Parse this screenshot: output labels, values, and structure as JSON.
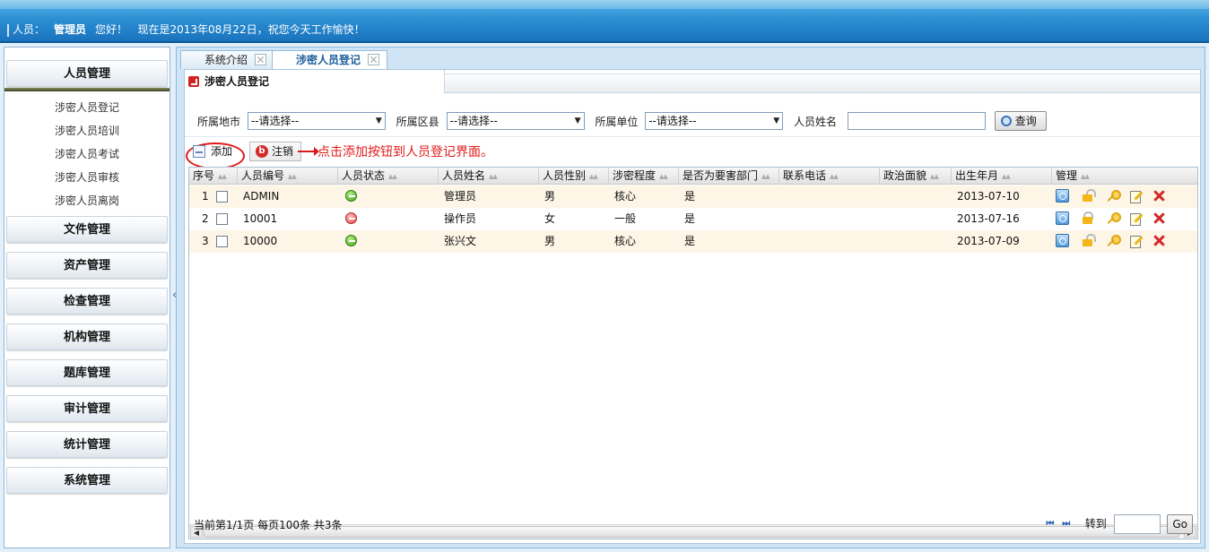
{
  "header": {
    "user_label": "人员：",
    "user_name": "管理员",
    "greeting": "您好！",
    "date_text": "现在是2013年08月22日，祝您今天工作愉快！"
  },
  "sidebar": {
    "active_menu": "人员管理",
    "sub_items": [
      "涉密人员登记",
      "涉密人员培训",
      "涉密人员考试",
      "涉密人员审核",
      "涉密人员离岗"
    ],
    "menus": [
      "文件管理",
      "资产管理",
      "检查管理",
      "机构管理",
      "题库管理",
      "审计管理",
      "统计管理",
      "系统管理"
    ],
    "collapse_glyph": "«"
  },
  "tabs": [
    {
      "label": "系统介绍",
      "active": false
    },
    {
      "label": "涉密人员登记",
      "active": true
    }
  ],
  "panel": {
    "title": "涉密人员登记"
  },
  "filters": {
    "city_label": "所属地市",
    "city_value": "--请选择--",
    "district_label": "所属区县",
    "district_value": "--请选择--",
    "unit_label": "所属单位",
    "unit_value": "--请选择--",
    "name_label": "人员姓名",
    "name_value": "",
    "query_button": "查询"
  },
  "toolbar": {
    "add_label": "添加",
    "cancel_label": "注销",
    "hint": "点击添加按钮到人员登记界面。"
  },
  "table": {
    "columns": [
      "序号",
      "人员编号",
      "人员状态",
      "人员姓名",
      "人员性别",
      "涉密程度",
      "是否为要害部门",
      "联系电话",
      "政治面貌",
      "出生年月",
      "管理"
    ],
    "rows": [
      {
        "index": "1",
        "id": "ADMIN",
        "status": "green",
        "name": "管理员",
        "gender": "男",
        "level": "核心",
        "key_dept": "是",
        "phone": "",
        "politics": "",
        "birth": "2013-07-10",
        "locked": false
      },
      {
        "index": "2",
        "id": "10001",
        "status": "red",
        "name": "操作员",
        "gender": "女",
        "level": "一般",
        "key_dept": "是",
        "phone": "",
        "politics": "",
        "birth": "2013-07-16",
        "locked": true
      },
      {
        "index": "3",
        "id": "10000",
        "status": "green",
        "name": "张兴文",
        "gender": "男",
        "level": "核心",
        "key_dept": "是",
        "phone": "",
        "politics": "",
        "birth": "2013-07-09",
        "locked": false
      }
    ]
  },
  "footer": {
    "page_info": "当前第1/1页 每页100条 共3条",
    "first_glyph": "⏮",
    "last_glyph": "⏭",
    "goto_label": "转到",
    "goto_value": "",
    "go_label": "Go"
  },
  "colors": {
    "header_blue": "#1a73bd",
    "accent_red": "#e01a1a",
    "row_highlight": "#fdf5e6"
  }
}
